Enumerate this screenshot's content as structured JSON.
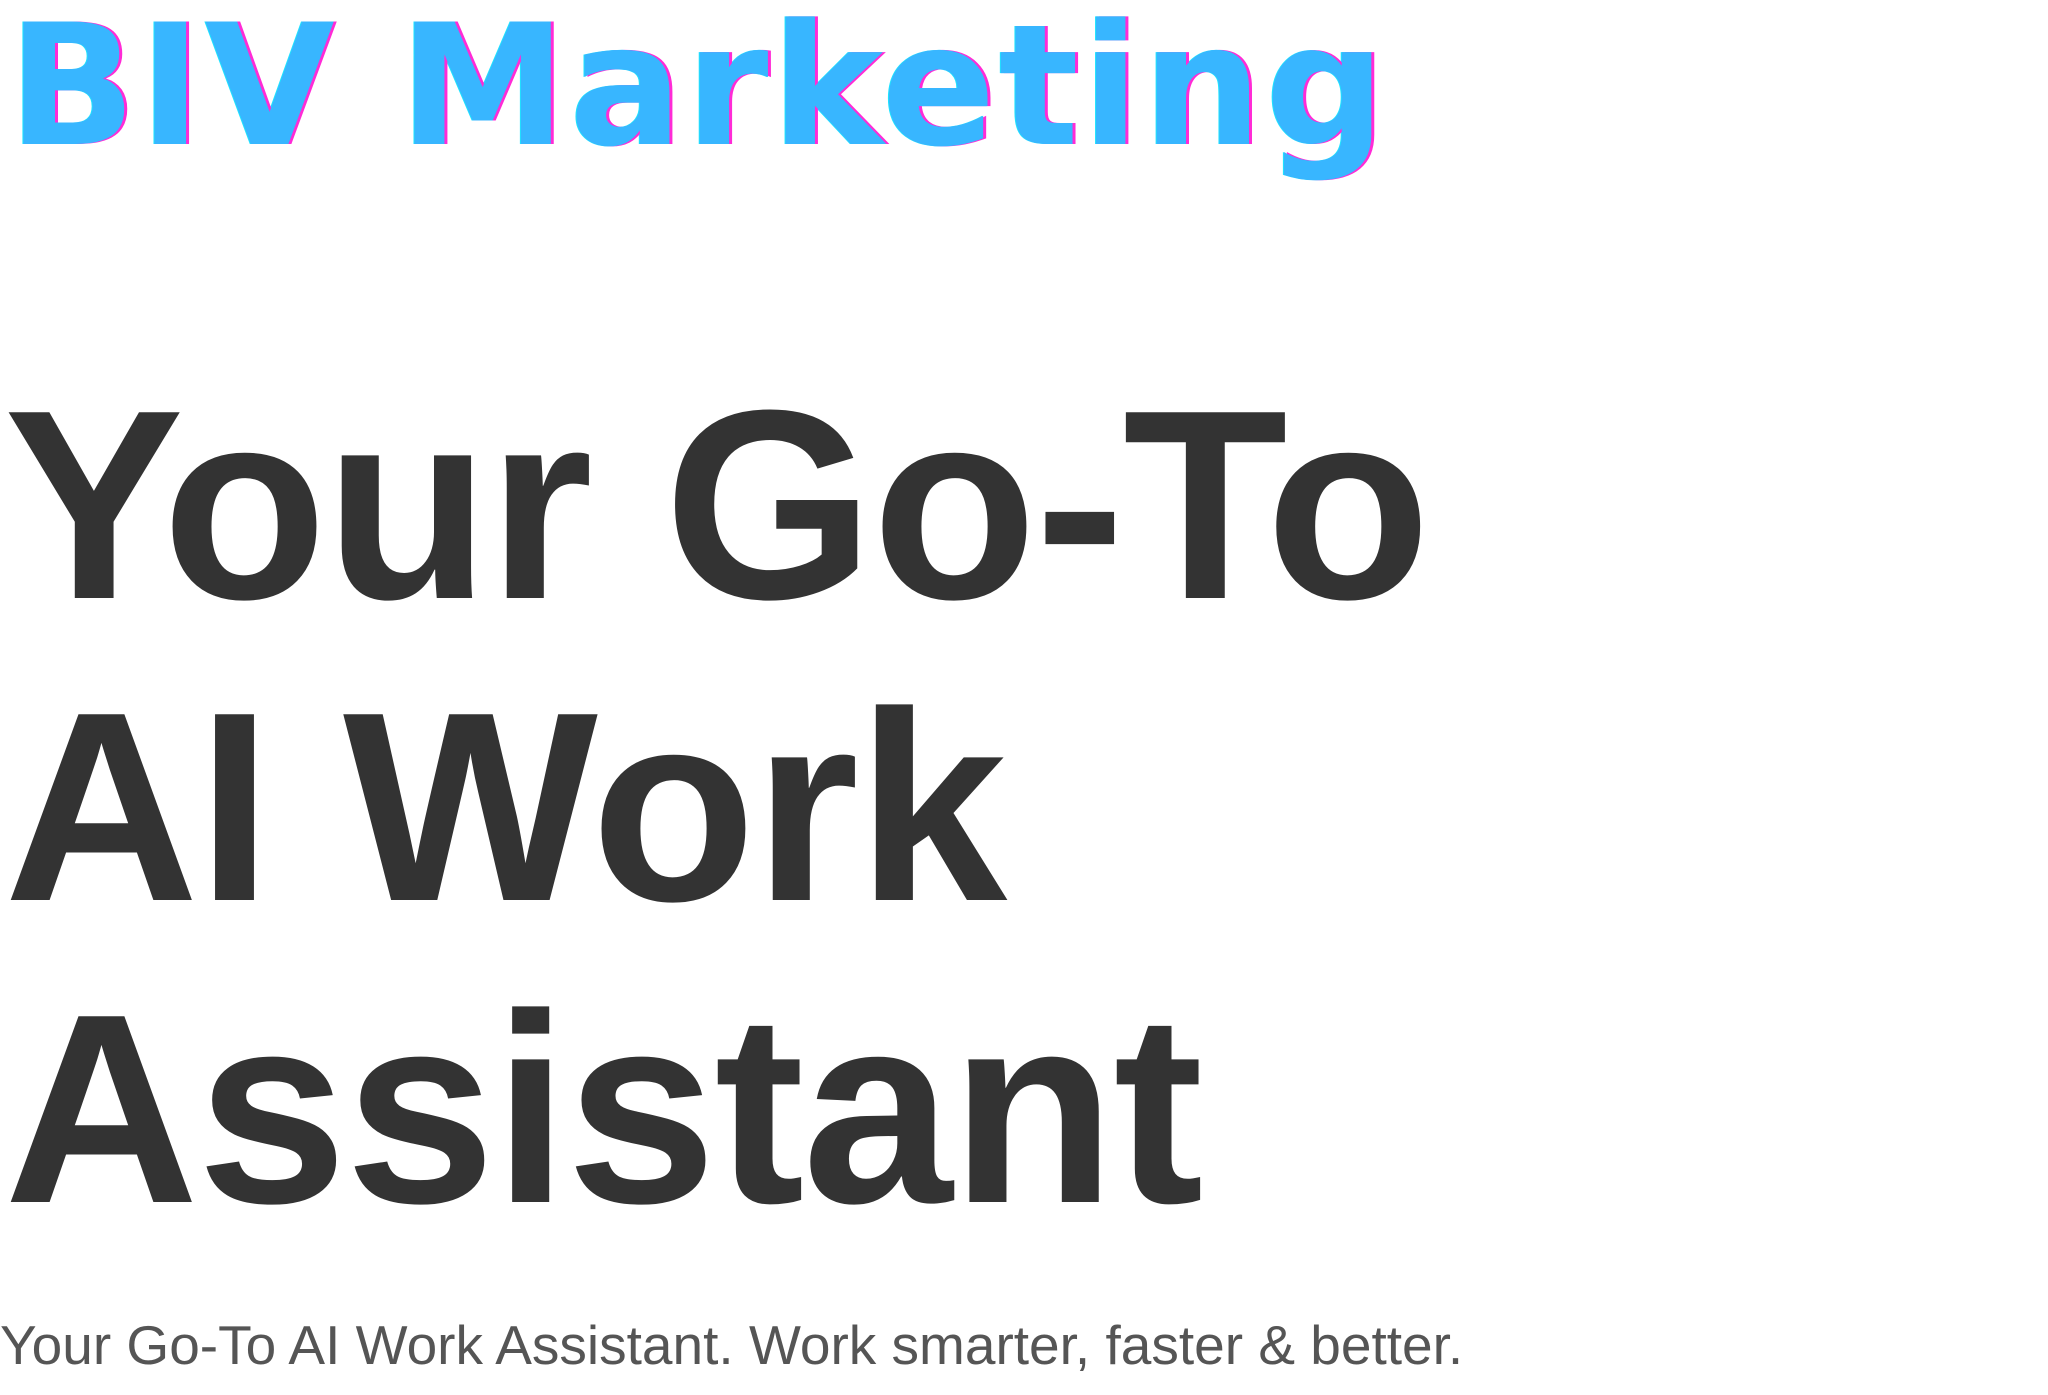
{
  "brand": {
    "name": "BIV Marketing",
    "color": "#38b6ff",
    "shadow_colors": [
      "#ff2bd6",
      "#1de4ff"
    ]
  },
  "hero": {
    "headline_lines": [
      "Your Go-To",
      "AI Work",
      "Assistant"
    ],
    "headline_color": "#333333",
    "tagline": "Your Go-To AI Work Assistant. Work smarter, faster & better.",
    "tagline_color": "#555555"
  },
  "colors": {
    "background": "#ffffff"
  }
}
